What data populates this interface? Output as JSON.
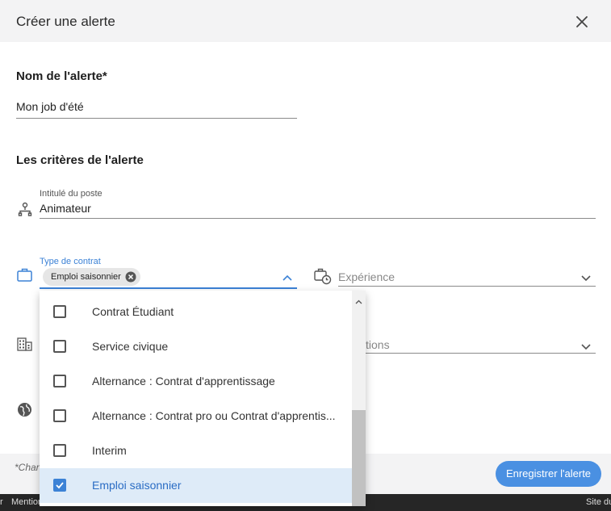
{
  "header": {
    "title": "Créer une alerte",
    "close_icon": "close-icon"
  },
  "alert_name": {
    "section_title": "Nom de l'alerte*",
    "value": "Mon job d'été"
  },
  "criteria": {
    "section_title": "Les critères de l'alerte",
    "job_title": {
      "label": "Intitulé du poste",
      "value": "Animateur",
      "icon": "sitemap-icon"
    },
    "contract_type": {
      "label": "Type de contrat",
      "chip": "Emploi saisonnier",
      "icon": "briefcase-icon"
    },
    "experience": {
      "placeholder": "Expérience",
      "icon": "briefcase-clock-icon"
    },
    "sector": {
      "placeholder_partial": "tions",
      "icon": "building-icon"
    },
    "location": {
      "icon": "globe-icon"
    }
  },
  "dropdown": {
    "options": [
      {
        "label": "Contrat Étudiant",
        "checked": false
      },
      {
        "label": "Service civique",
        "checked": false
      },
      {
        "label": "Alternance : Contrat d'apprentissage",
        "checked": false
      },
      {
        "label": "Alternance : Contrat pro ou Contrat d'apprentis...",
        "checked": false
      },
      {
        "label": "Interim",
        "checked": false
      },
      {
        "label": "Emploi saisonnier",
        "checked": true
      }
    ]
  },
  "footer": {
    "note": "*Char",
    "save_label": "Enregistrer l'alerte"
  },
  "bottom_bar": {
    "left_text": "r",
    "mention": "Mention",
    "right_text": "Site du"
  },
  "colors": {
    "accent": "#4a90e2",
    "selected_bg": "#deebf8",
    "header_bg": "#f3f3f4"
  }
}
